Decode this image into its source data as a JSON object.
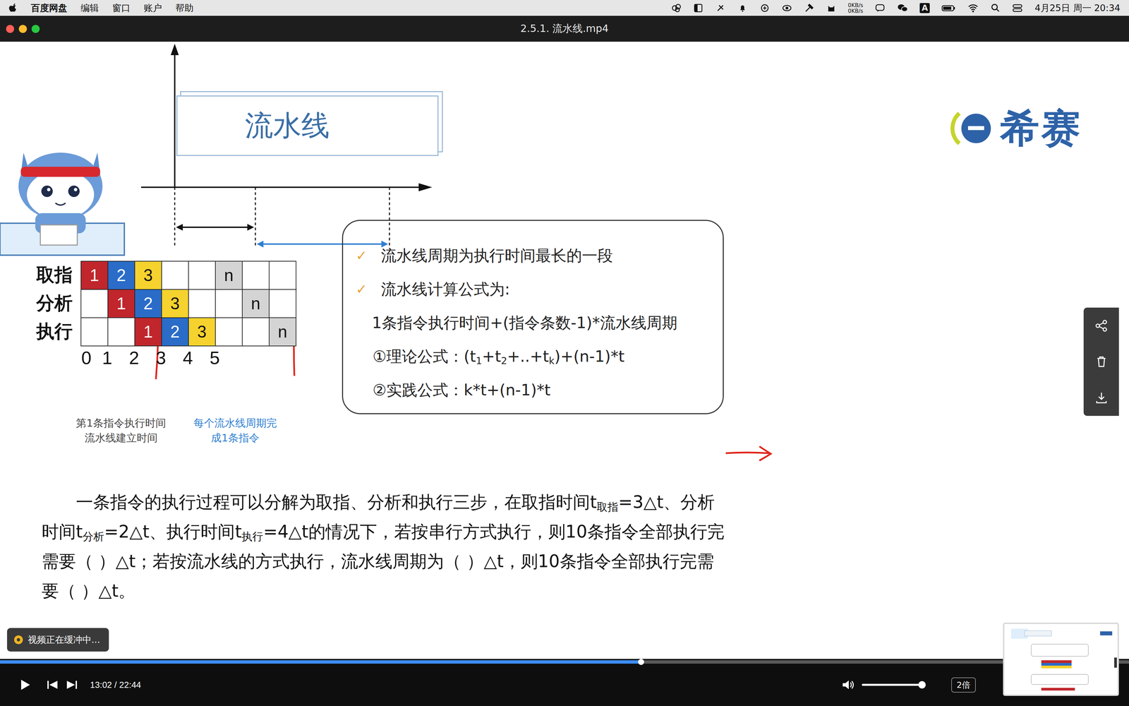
{
  "menubar": {
    "app": "百度网盘",
    "items": [
      "编辑",
      "窗口",
      "账户",
      "帮助"
    ],
    "net_speed": [
      "0KB/s",
      "0KB/s"
    ],
    "input_method": "A",
    "clock": "4月25日 周一 20:34"
  },
  "window": {
    "title": "2.5.1. 流水线.mp4"
  },
  "slide": {
    "title": "流水线",
    "logo": "希赛",
    "diagram": {
      "rows": [
        {
          "label": "取指",
          "cells": [
            {
              "text": "1",
              "color": "#c0262c"
            },
            {
              "text": "2",
              "color": "#2a6cc8"
            },
            {
              "text": "3",
              "color": "#f6d22e"
            },
            {
              "text": "",
              "color": "#ffffff"
            },
            {
              "text": "",
              "color": "#ffffff"
            },
            {
              "text": "n",
              "color": "#d4d4d4"
            },
            {
              "text": "",
              "color": "#ffffff"
            },
            {
              "text": "",
              "color": "#ffffff"
            }
          ]
        },
        {
          "label": "分析",
          "cells": [
            {
              "text": "",
              "color": "#ffffff"
            },
            {
              "text": "1",
              "color": "#c0262c"
            },
            {
              "text": "2",
              "color": "#2a6cc8"
            },
            {
              "text": "3",
              "color": "#f6d22e"
            },
            {
              "text": "",
              "color": "#ffffff"
            },
            {
              "text": "",
              "color": "#ffffff"
            },
            {
              "text": "n",
              "color": "#d4d4d4"
            },
            {
              "text": "",
              "color": "#ffffff"
            }
          ]
        },
        {
          "label": "执行",
          "cells": [
            {
              "text": "",
              "color": "#ffffff"
            },
            {
              "text": "",
              "color": "#ffffff"
            },
            {
              "text": "1",
              "color": "#c0262c"
            },
            {
              "text": "2",
              "color": "#2a6cc8"
            },
            {
              "text": "3",
              "color": "#f6d22e"
            },
            {
              "text": "",
              "color": "#ffffff"
            },
            {
              "text": "",
              "color": "#ffffff"
            },
            {
              "text": "n",
              "color": "#d4d4d4"
            }
          ]
        }
      ],
      "ticks": [
        "0",
        "1",
        "2",
        "3",
        "4",
        "5"
      ],
      "caption_left": [
        "第1条指令执行时间",
        "流水线建立时间"
      ],
      "caption_right": [
        "每个流水线周期完",
        "成1条指令"
      ]
    },
    "notes": [
      {
        "check": "✓",
        "text": "流水线周期为执行时间最长的一段"
      },
      {
        "check": "✓",
        "text": "流水线计算公式为:"
      }
    ],
    "formula": "1条指令执行时间+(指令条数-1)*流水线周期",
    "theory": [
      {
        "t": "①理论公式：(t",
        "sub": false
      },
      {
        "t": "1",
        "sub": true
      },
      {
        "t": "+t",
        "sub": false
      },
      {
        "t": "2",
        "sub": true
      },
      {
        "t": "+..+t",
        "sub": false
      },
      {
        "t": "k",
        "sub": true
      },
      {
        "t": ")+(n-1)*t",
        "sub": false
      }
    ],
    "practice": [
      {
        "t": "②实践公式：k*t+(n-1)*t",
        "sub": false
      }
    ],
    "question": [
      {
        "t": "一条指令的执行过程可以分解为取指、分析和执行三步，在取指时间t",
        "sub": false
      },
      {
        "t": "取指",
        "sub": true
      },
      {
        "t": "=3△t、分析时间t",
        "sub": false
      },
      {
        "t": "分析",
        "sub": true
      },
      {
        "t": "=2△t、执行时间t",
        "sub": false
      },
      {
        "t": "执行",
        "sub": true
      },
      {
        "t": "=4△t的情况下，若按串行方式执行，则10条指令全部执行完需要（ ）△t；若按流水线的方式执行，流水线周期为（ ）△t，则10条指令全部执行完需要（ ）△t。",
        "sub": false
      }
    ]
  },
  "toast": "视频正在缓冲中...",
  "player": {
    "progress": 0.568,
    "time": "13:02 / 22:44",
    "volume": 0.94,
    "speed": "2倍"
  }
}
